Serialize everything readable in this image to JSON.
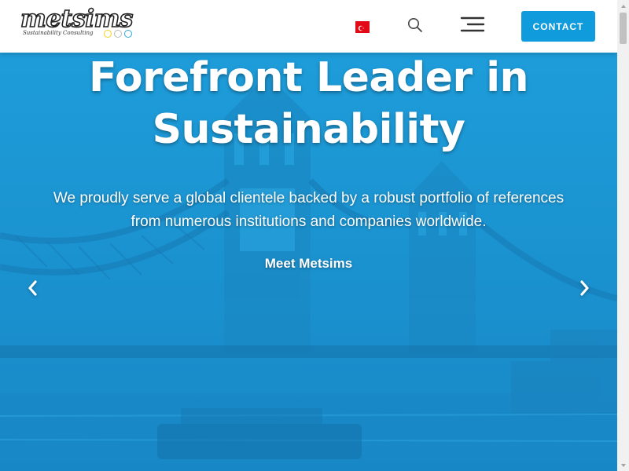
{
  "header": {
    "logo_text": "metsims",
    "logo_tagline": "Sustainability Consulting",
    "logo_dot_colors": [
      "#f2d21b",
      "#b8b8b8",
      "#2aa6e0"
    ],
    "language_flag": "turkey-flag",
    "search_icon": "search-icon",
    "menu_icon": "hamburger-menu-icon",
    "contact_label": "CONTACT"
  },
  "hero": {
    "title_line1": "Forefront Leader in",
    "title_line2": "Sustainability",
    "subtitle_line1": "We proudly serve a global clientele backed by a robust portfolio of references",
    "subtitle_line2": "from numerous institutions and companies worldwide.",
    "cta_label": "Meet Metsims",
    "prev_icon": "chevron-left-icon",
    "next_icon": "chevron-right-icon"
  },
  "colors": {
    "accent": "#109bdc",
    "hero_overlay": "#1e9fdc",
    "flag_red": "#e30a17"
  }
}
